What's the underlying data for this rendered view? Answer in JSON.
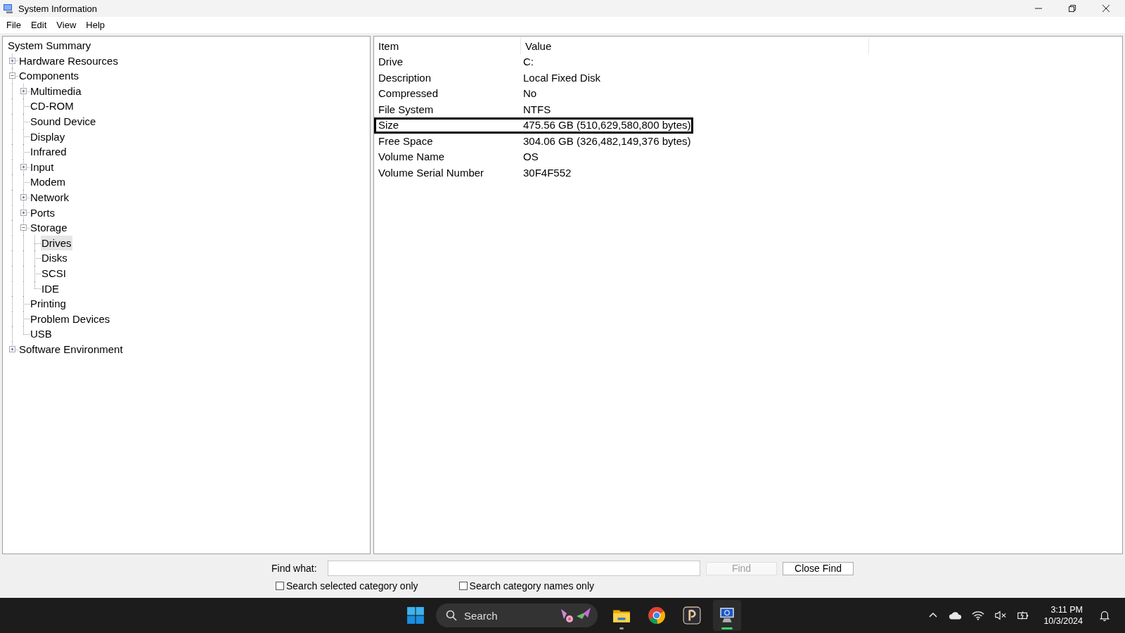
{
  "window": {
    "title": "System Information"
  },
  "menu": [
    "File",
    "Edit",
    "View",
    "Help"
  ],
  "tree": [
    {
      "label": "System Summary",
      "selected": false,
      "children": [
        {
          "label": "Hardware Resources",
          "selected": false,
          "expanded": false
        },
        {
          "label": "Components",
          "selected": false,
          "expanded": true,
          "children": [
            {
              "label": "Multimedia",
              "selected": false,
              "expanded": false
            },
            {
              "label": "CD-ROM",
              "selected": false
            },
            {
              "label": "Sound Device",
              "selected": false
            },
            {
              "label": "Display",
              "selected": false
            },
            {
              "label": "Infrared",
              "selected": false
            },
            {
              "label": "Input",
              "selected": false,
              "expanded": false
            },
            {
              "label": "Modem",
              "selected": false
            },
            {
              "label": "Network",
              "selected": false,
              "expanded": false
            },
            {
              "label": "Ports",
              "selected": false,
              "expanded": false
            },
            {
              "label": "Storage",
              "selected": false,
              "expanded": true,
              "children": [
                {
                  "label": "Drives",
                  "selected": true
                },
                {
                  "label": "Disks",
                  "selected": false
                },
                {
                  "label": "SCSI",
                  "selected": false
                },
                {
                  "label": "IDE",
                  "selected": false
                }
              ]
            },
            {
              "label": "Printing",
              "selected": false
            },
            {
              "label": "Problem Devices",
              "selected": false
            },
            {
              "label": "USB",
              "selected": false
            }
          ]
        },
        {
          "label": "Software Environment",
          "selected": false,
          "expanded": false
        }
      ]
    }
  ],
  "table": {
    "columns": [
      "Item",
      "Value"
    ],
    "rows": [
      {
        "item": "Drive",
        "value": "C:",
        "outlined": false
      },
      {
        "item": "Description",
        "value": "Local Fixed Disk",
        "outlined": false
      },
      {
        "item": "Compressed",
        "value": "No",
        "outlined": false
      },
      {
        "item": "File System",
        "value": "NTFS",
        "outlined": false
      },
      {
        "item": "Size",
        "value": "475.56 GB (510,629,580,800 bytes)",
        "outlined": true
      },
      {
        "item": "Free Space",
        "value": "304.06 GB (326,482,149,376 bytes)",
        "outlined": false
      },
      {
        "item": "Volume Name",
        "value": "OS",
        "outlined": false
      },
      {
        "item": "Volume Serial Number",
        "value": "30F4F552",
        "outlined": false
      }
    ]
  },
  "find": {
    "label": "Find what:",
    "find_button": {
      "label": "Find",
      "disabled": true
    },
    "close_button": "Close Find",
    "checkboxes": [
      {
        "label": "Search selected category only",
        "checked": false
      },
      {
        "label": "Search category names only",
        "checked": false
      }
    ]
  },
  "taskbar": {
    "search": {
      "placeholder": "Search"
    },
    "apps": [
      {
        "kind": "folder",
        "open": true,
        "active": false
      },
      {
        "kind": "chrome",
        "open": false,
        "active": false
      },
      {
        "kind": "notes",
        "open": false,
        "active": false
      },
      {
        "kind": "sysinfo",
        "open": true,
        "active": true
      }
    ],
    "clock": {
      "time": "3:11 PM",
      "date": "10/3/2024"
    }
  }
}
